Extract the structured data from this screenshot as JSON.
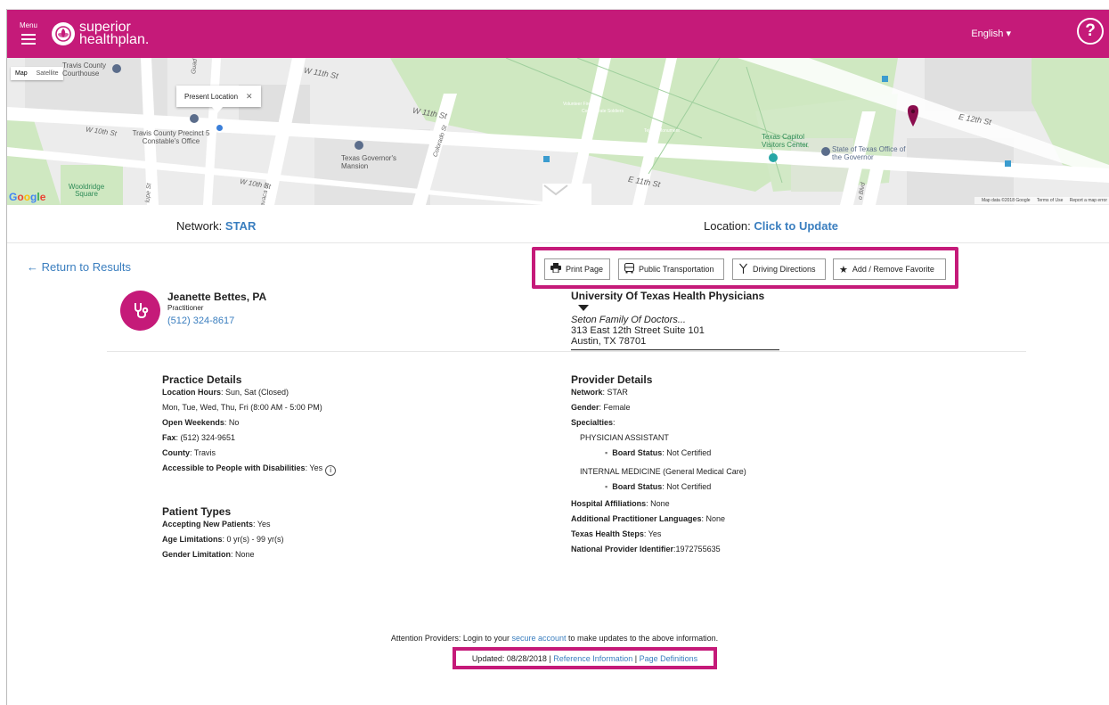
{
  "header": {
    "menu_label": "Menu",
    "logo_line1": "superior",
    "logo_line2": "healthplan.",
    "language": "English ▾",
    "help": "?"
  },
  "map": {
    "type_map": "Map",
    "type_satellite": "Satellite",
    "popup_text": "Present Location",
    "popup_close": "✕",
    "labels": {
      "travis_courthouse": "Travis County Courthouse",
      "w11_left": "W 11th St",
      "w11_mid": "W 11th St",
      "w10_left": "W 10th St",
      "precinct": "Travis County Precinct 5 Constable's Office",
      "governor_mansion": "Texas Governor's Mansion",
      "volunteer": "Volunteer Firemen",
      "confederate": "Confederate Soldiers",
      "tejano": "Tejano Monument",
      "visitors_center": "Texas Capitol Visitors Center",
      "office_governor": "State of Texas Office of the Governor",
      "e12": "E 12th St",
      "e11": "E 11th St",
      "w10_bottom": "W 10th St",
      "wooldridge": "Wooldridge Square",
      "colorado": "Colorado St",
      "lavaca": "avaca St",
      "guad": "Guad",
      "lupe": "lupe St",
      "blvd": "o Blvd"
    },
    "google": "Google",
    "footer_data": "Map data ©2018 Google",
    "footer_terms": "Terms of Use",
    "footer_report": "Report a map error"
  },
  "network": {
    "label": "Network: ",
    "value": "STAR"
  },
  "location": {
    "label": "Location: ",
    "value": "Click to Update"
  },
  "back_link": "← Return to Results",
  "toolbar": {
    "print": "Print Page",
    "transport": "Public Transportation",
    "driving": "Driving Directions",
    "favorite": "Add / Remove Favorite"
  },
  "provider": {
    "name": "Jeanette Bettes, PA",
    "role": "Practitioner",
    "phone": "(512) 324-8617"
  },
  "clinic": {
    "name": "University Of Texas Health Physicians",
    "subtitle": "Seton Family Of Doctors...",
    "address1": "313 East 12th Street Suite 101",
    "address2": "Austin, TX 78701"
  },
  "practice": {
    "heading": "Practice Details",
    "hours_label": "Location Hours",
    "hours_value": ": Sun, Sat (Closed)",
    "hours_line2": "Mon, Tue, Wed, Thu, Fri (8:00 AM - 5:00 PM)",
    "weekends_label": "Open Weekends",
    "weekends_value": ": No",
    "fax_label": "Fax",
    "fax_value": ": (512) 324-9651",
    "county_label": "County",
    "county_value": ": Travis",
    "accessible_label": "Accessible to People with Disabilities",
    "accessible_value": ": Yes",
    "info_icon": "i"
  },
  "patient": {
    "heading": "Patient Types",
    "accepting_label": "Accepting New Patients",
    "accepting_value": ": Yes",
    "age_label": "Age Limitations",
    "age_value": ": 0 yr(s) - 99 yr(s)",
    "gender_label": "Gender Limitation",
    "gender_value": ": None"
  },
  "provider_details": {
    "heading": "Provider Details",
    "network_label": "Network",
    "network_value": ": STAR",
    "gender_label": "Gender",
    "gender_value": ": Female",
    "specialties_label": "Specialties",
    "specialties_colon": ":",
    "specialty1": "PHYSICIAN ASSISTANT",
    "board1_label": "Board Status",
    "board1_value": ": Not Certified",
    "specialty2": "INTERNAL MEDICINE (General Medical Care)",
    "board2_label": "Board Status",
    "board2_value": ": Not Certified",
    "hospital_label": "Hospital Affiliations",
    "hospital_value": ": None",
    "languages_label": "Additional Practitioner Languages",
    "languages_value": ": None",
    "ths_label": "Texas Health Steps",
    "ths_value": ": Yes",
    "npi_label": "National Provider Identifier",
    "npi_value": ":1972755635",
    "bullet": "▪"
  },
  "footer": {
    "attn_pre": "Attention Providers: Login to your ",
    "attn_link": "secure account",
    "attn_post": " to make updates to the above information.",
    "updated": "Updated: 08/28/2018 | ",
    "reference": "Reference Information",
    "sep": " | ",
    "definitions": "Page Definitions"
  },
  "colors": {
    "brand": "#c51a79",
    "link": "#3a7ebf"
  }
}
